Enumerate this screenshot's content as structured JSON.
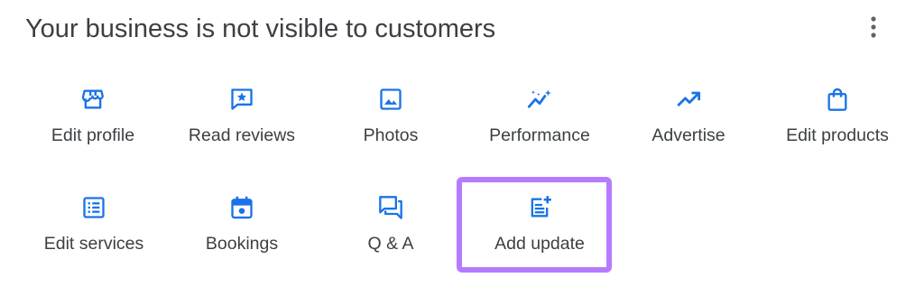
{
  "header": {
    "title": "Your business is not visible to customers",
    "more_icon": "more-vert-icon"
  },
  "actions_row1": [
    {
      "label": "Edit profile",
      "icon": "storefront-icon"
    },
    {
      "label": "Read reviews",
      "icon": "review-star-icon"
    },
    {
      "label": "Photos",
      "icon": "photo-icon"
    },
    {
      "label": "Performance",
      "icon": "performance-sparkle-icon"
    },
    {
      "label": "Advertise",
      "icon": "trending-up-icon"
    },
    {
      "label": "Edit products",
      "icon": "shopping-bag-icon"
    }
  ],
  "actions_row2": [
    {
      "label": "Edit services",
      "icon": "list-icon"
    },
    {
      "label": "Bookings",
      "icon": "calendar-icon"
    },
    {
      "label": "Q & A",
      "icon": "chat-bubbles-icon"
    },
    {
      "label": "Add update",
      "icon": "post-add-icon"
    }
  ],
  "colors": {
    "icon_blue": "#1a73e8",
    "highlight_border": "#b57bff",
    "text": "#3c4043"
  }
}
